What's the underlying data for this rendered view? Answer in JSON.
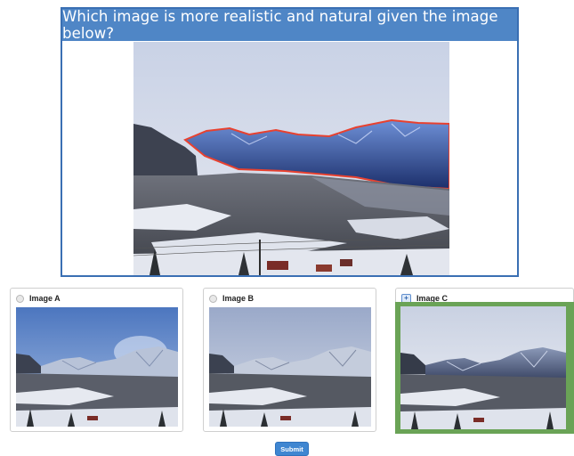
{
  "question": {
    "text": "Which image is more realistic and natural given the image below?"
  },
  "options": [
    {
      "label": "Image A",
      "selected": false
    },
    {
      "label": "Image B",
      "selected": false
    },
    {
      "label": "Image C",
      "selected": true
    }
  ],
  "submit": {
    "label": "Submit"
  },
  "colors": {
    "header_blue": "#4f86c6",
    "panel_border": "#3a6fb3",
    "selected_green": "#6aa356",
    "mask_outline": "#e8412f",
    "button_blue": "#3f86d1"
  },
  "icons": {
    "radio_unchecked": "radio-unchecked-icon",
    "radio_checked": "radio-checked-icon"
  }
}
